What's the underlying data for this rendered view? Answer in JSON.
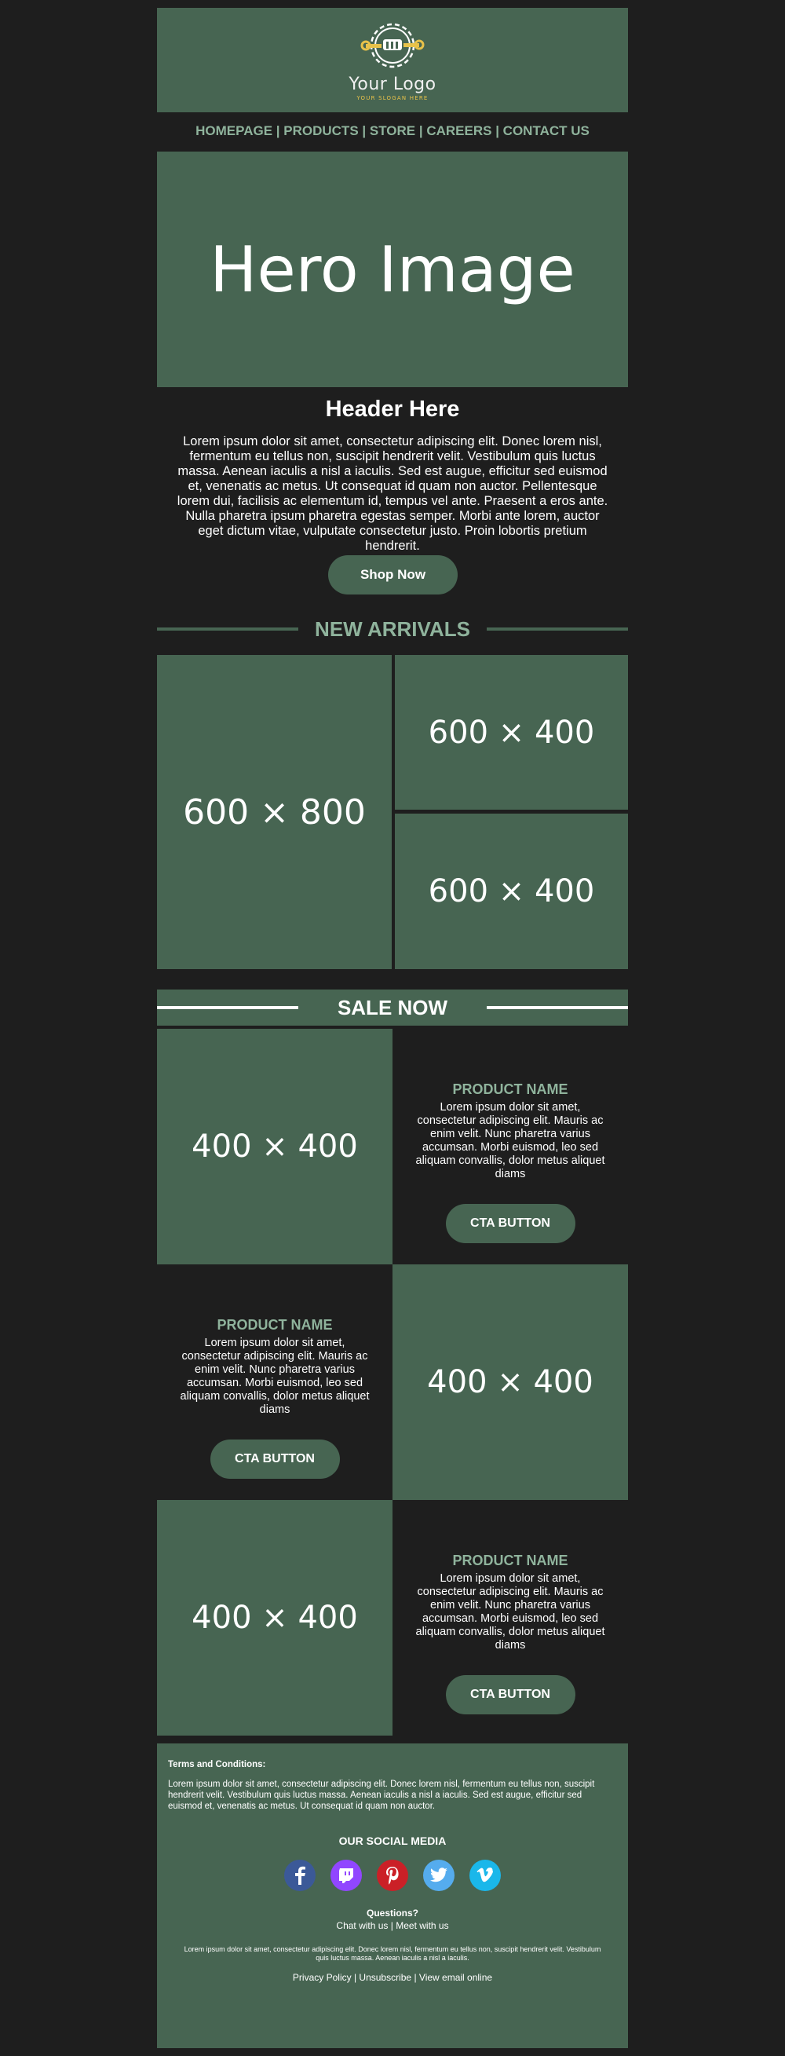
{
  "logo": {
    "text": "Your Logo",
    "slogan": "YOUR SLOGAN HERE"
  },
  "nav": {
    "items": [
      "HOMEPAGE",
      "PRODUCTS",
      "STORE",
      "CAREERS",
      "CONTACT US"
    ],
    "separator": " | "
  },
  "hero": {
    "label": "Hero Image"
  },
  "intro": {
    "title": "Header Here",
    "text": "Lorem ipsum dolor sit amet, consectetur adipiscing elit. Donec lorem nisl, fermentum eu tellus non, suscipit hendrerit velit. Vestibulum quis luctus massa. Aenean iaculis a nisl a iaculis. Sed est augue, efficitur sed euismod et, venenatis ac metus. Ut consequat id quam non auctor. Pellentesque lorem dui, facilisis ac elementum id, tempus vel ante. Praesent a eros ante. Nulla pharetra ipsum pharetra egestas semper. Morbi ante lorem, auctor eget dictum vitae, vulputate consectetur justo. Proin lobortis pretium hendrerit.",
    "button": "Shop Now"
  },
  "new_arrivals": {
    "title": "NEW ARRIVALS",
    "big": "600 × 800",
    "top": "600 × 400",
    "bottom": "600 × 400"
  },
  "sale": {
    "title": "SALE NOW",
    "products": [
      {
        "image": "400 × 400",
        "name": "PRODUCT NAME",
        "desc": "Lorem ipsum dolor sit amet, consectetur adipiscing elit. Mauris ac enim velit. Nunc pharetra varius accumsan. Morbi euismod, leo sed aliquam convallis, dolor metus aliquet diams",
        "button": "CTA BUTTON"
      },
      {
        "image": "400 × 400",
        "name": "PRODUCT NAME",
        "desc": "Lorem ipsum dolor sit amet, consectetur adipiscing elit. Mauris ac enim velit. Nunc pharetra varius accumsan. Morbi euismod, leo sed aliquam convallis, dolor metus aliquet diams",
        "button": "CTA BUTTON"
      },
      {
        "image": "400 × 400",
        "name": "PRODUCT NAME",
        "desc": "Lorem ipsum dolor sit amet, consectetur adipiscing elit. Mauris ac enim velit. Nunc pharetra varius accumsan. Morbi euismod, leo sed aliquam convallis, dolor metus aliquet diams",
        "button": "CTA BUTTON"
      }
    ]
  },
  "terms": {
    "title": "Terms and Conditions:",
    "text": "Lorem ipsum dolor sit amet, consectetur adipiscing elit. Donec lorem nisl, fermentum eu tellus non, suscipit hendrerit velit. Vestibulum quis luctus massa. Aenean iaculis a nisl a iaculis. Sed est augue, efficitur sed euismod et, venenatis ac metus. Ut consequat id quam non auctor."
  },
  "footer": {
    "title": "OUR SOCIAL MEDIA",
    "socials": [
      {
        "name": "facebook-icon",
        "color": "#3b5998"
      },
      {
        "name": "twitch-icon",
        "color": "#9146ff"
      },
      {
        "name": "pinterest-icon",
        "color": "#cb2027"
      },
      {
        "name": "twitter-icon",
        "color": "#55acee"
      },
      {
        "name": "vimeo-icon",
        "color": "#1ab7ea"
      }
    ],
    "questions": "Questions?",
    "chat": "Chat with us",
    "meet": "Meet with us",
    "small": "Lorem ipsum dolor sit amet, consectetur adipiscing elit. Donec lorem nisl, fermentum eu tellus non, suscipit hendrerit velit. Vestibulum quis luctus massa. Aenean iaculis a nisl a iaculis.",
    "privacy": "Privacy Policy",
    "unsubscribe": "Unsubscribe",
    "view_online": "View email online"
  },
  "colors": {
    "background": "#1e1e1e",
    "panel": "#476552",
    "accent_text": "#8fb39c",
    "logo_gold": "#e8c24a"
  }
}
